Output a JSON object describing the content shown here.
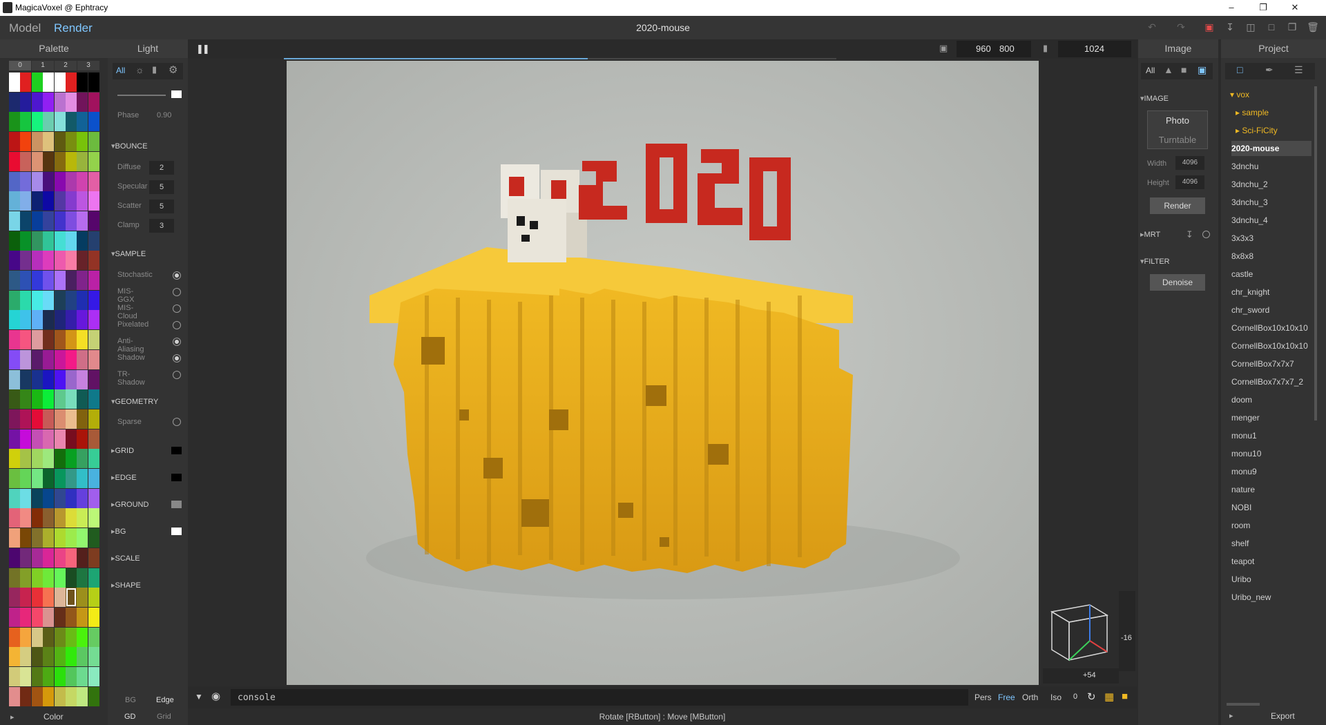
{
  "window": {
    "title": "MagicaVoxel @ Ephtracy",
    "min_label": "–",
    "max_label": "❐",
    "close_label": "✕"
  },
  "menu": {
    "model_tab": "Model",
    "render_tab": "Render",
    "document_title": "2020-mouse"
  },
  "palette": {
    "header": "Palette",
    "page_tabs": [
      "0",
      "1",
      "2",
      "3"
    ],
    "footer_label": "Color",
    "selected_index": 213
  },
  "light": {
    "header": "Light",
    "filter_all": "All",
    "phase_label": "Phase",
    "phase_value": "0.90",
    "bounce": {
      "title": "BOUNCE",
      "rows": [
        {
          "label": "Diffuse",
          "value": "2"
        },
        {
          "label": "Specular",
          "value": "5"
        },
        {
          "label": "Scatter",
          "value": "5"
        },
        {
          "label": "Clamp",
          "value": "3"
        }
      ]
    },
    "sample": {
      "title": "SAMPLE",
      "options": [
        {
          "label": "Stochastic",
          "on": true
        },
        {
          "label": "MIS-GGX",
          "on": false
        },
        {
          "label": "MIS-Cloud",
          "on": false
        },
        {
          "label": "Pixelated",
          "on": false
        },
        {
          "label": "Anti-Aliasing",
          "on": true
        },
        {
          "label": "Shadow",
          "on": true
        },
        {
          "label": "TR-Shadow",
          "on": false
        }
      ]
    },
    "geometry": {
      "title": "GEOMETRY",
      "sparse_label": "Sparse"
    },
    "collapsed_sections": [
      {
        "title": "GRID",
        "color": "#000000"
      },
      {
        "title": "EDGE",
        "color": "#000000"
      },
      {
        "title": "GROUND",
        "color": "#888888"
      },
      {
        "title": "BG",
        "color": "#ffffff"
      },
      {
        "title": "SCALE",
        "color": ""
      },
      {
        "title": "SHAPE",
        "color": ""
      }
    ],
    "bottom_toggles": {
      "bg": "BG",
      "edge": "Edge",
      "gd": "GD",
      "grid": "Grid"
    }
  },
  "viewport": {
    "size_w": "960",
    "size_h": "800",
    "sample_count": "1024",
    "progress": 0.55,
    "camera_readout_y": "-16",
    "camera_readout_x": "+54",
    "console_placeholder": "console",
    "projection_modes": [
      "Pers",
      "Free",
      "Orth",
      "Iso"
    ],
    "active_projection": "Free",
    "projection_zero": "0",
    "status_hint": "Rotate [RButton] : Move [MButton]"
  },
  "scene": {
    "title_text": "2020",
    "colors": {
      "cheese": "#e7b01e",
      "numbers": "#c7291f",
      "mouse": "#e8e4d9",
      "background": "#b7bab6"
    }
  },
  "image": {
    "header": "Image",
    "filter_all": "All",
    "section_image": "IMAGE",
    "photo_label": "Photo",
    "turntable_label": "Turntable",
    "width_label": "Width",
    "width_value": "4096",
    "height_label": "Height",
    "height_value": "4096",
    "render_label": "Render",
    "section_mrt": "MRT",
    "section_filter": "FILTER",
    "denoise_label": "Denoise"
  },
  "project": {
    "header": "Project",
    "folder_vox": "vox",
    "subfolders": [
      "sample",
      "Sci-FiCity"
    ],
    "selected": "2020-mouse",
    "items": [
      "2020-mouse",
      "3dnchu",
      "3dnchu_2",
      "3dnchu_3",
      "3dnchu_4",
      "3x3x3",
      "8x8x8",
      "castle",
      "chr_knight",
      "chr_sword",
      "CornellBox10x10x10",
      "CornellBox10x10x10",
      "CornellBox7x7x7",
      "CornellBox7x7x7_2",
      "doom",
      "menger",
      "monu1",
      "monu10",
      "monu9",
      "nature",
      "NOBI",
      "room",
      "shelf",
      "teapot",
      "Uribo",
      "Uribo_new"
    ],
    "export_label": "Export"
  }
}
